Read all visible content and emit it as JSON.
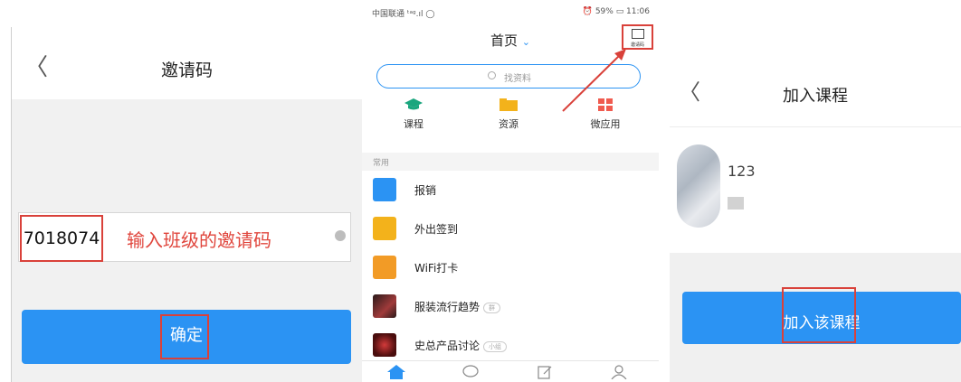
{
  "invite_screen": {
    "back": "〈",
    "title": "邀请码",
    "code_value": "7018074",
    "hint": "输入班级的邀请码",
    "confirm_label": "确定"
  },
  "home_screen": {
    "status_left": "中国联通 ᵗᵃᵍ.ıl ◯",
    "status_right": "⏰ 59% ▭ 11:06",
    "title": "首页",
    "title_chevron": "⌄",
    "scan_label": "邀请码",
    "search_placeholder": "找资料",
    "categories": [
      {
        "label": "课程",
        "icon": "graduation-cap-icon",
        "color": "#1aa67e"
      },
      {
        "label": "资源",
        "icon": "folder-icon",
        "color": "#f3b21b"
      },
      {
        "label": "微应用",
        "icon": "grid-icon",
        "color": "#f05b4f"
      }
    ],
    "section_label": "常用",
    "items": [
      {
        "label": "报销",
        "icon": "reimburse-icon",
        "color": "#2b93f3",
        "badge": ""
      },
      {
        "label": "外出签到",
        "icon": "checkin-icon",
        "color": "#f3b21b",
        "badge": ""
      },
      {
        "label": "WiFi打卡",
        "icon": "wifi-clock-icon",
        "color": "#f29b26",
        "badge": ""
      },
      {
        "label": "服装流行趋势",
        "icon": "fashion-thumb-icon",
        "color": "#6a3b3b",
        "badge": "群"
      },
      {
        "label": "史总产品讨论",
        "icon": "product-thumb-icon",
        "color": "#9a1f1f",
        "badge": "小组"
      }
    ],
    "tabs": [
      "home-tab-icon",
      "message-tab-icon",
      "note-tab-icon",
      "profile-tab-icon"
    ]
  },
  "join_screen": {
    "back": "〈",
    "title": "加入课程",
    "course_number": "123",
    "join_label": "加入该课程"
  },
  "colors": {
    "accent": "#2b93f3",
    "highlight": "#d9413a"
  }
}
